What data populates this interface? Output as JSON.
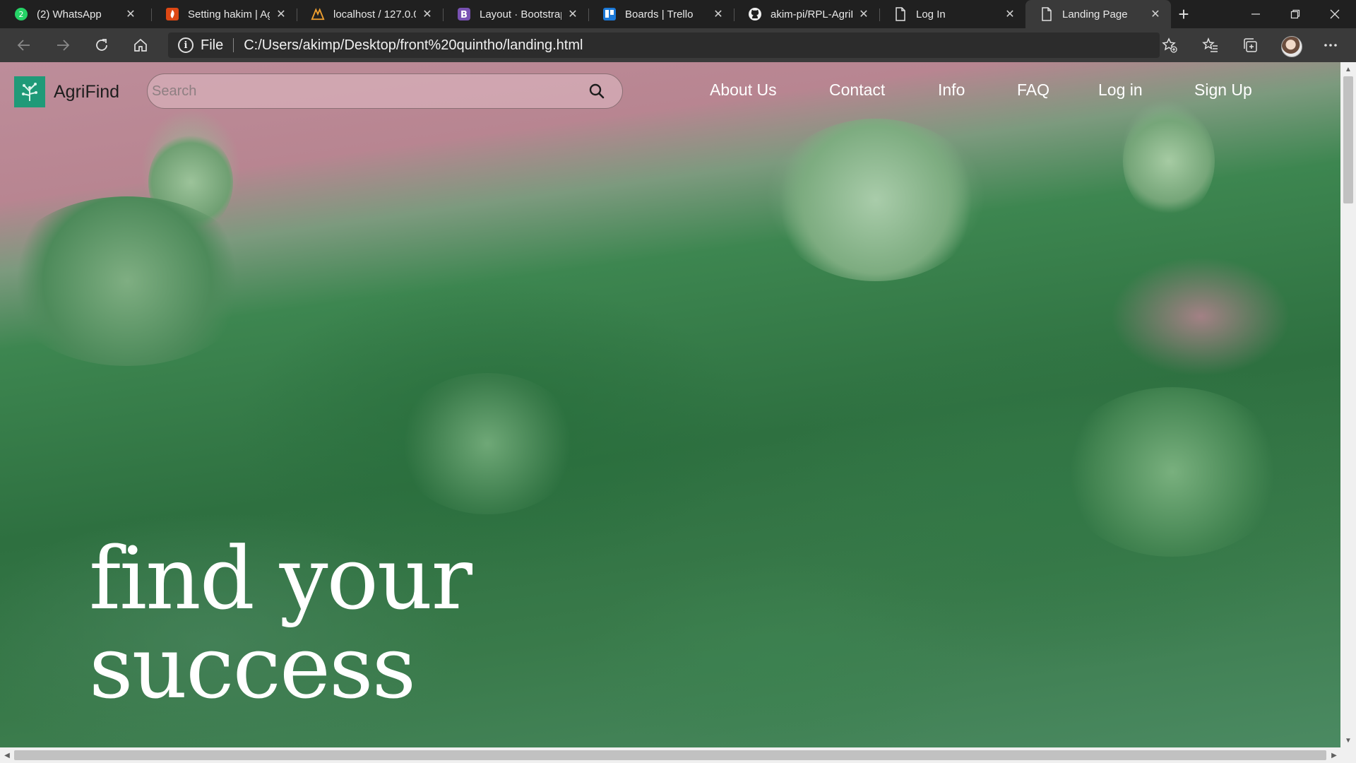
{
  "browser": {
    "tabs": [
      {
        "title": "(2) WhatsApp",
        "icon": "whatsapp-icon",
        "active": false
      },
      {
        "title": "Setting hakim | Ag",
        "icon": "codeigniter-icon",
        "active": false
      },
      {
        "title": "localhost / 127.0.0",
        "icon": "phpmyadmin-icon",
        "active": false
      },
      {
        "title": "Layout · Bootstrap",
        "icon": "bootstrap-icon",
        "active": false
      },
      {
        "title": "Boards | Trello",
        "icon": "trello-icon",
        "active": false
      },
      {
        "title": "akim-pi/RPL-AgriF",
        "icon": "github-icon",
        "active": false
      },
      {
        "title": "Log In",
        "icon": "page-icon",
        "active": false
      },
      {
        "title": "Landing Page",
        "icon": "page-icon",
        "active": true
      }
    ],
    "address": {
      "scheme": "File",
      "url": "C:/Users/akimp/Desktop/front%20quintho/landing.html"
    }
  },
  "page": {
    "brand": {
      "name": "AgriFind",
      "logo_color": "#1f9a78"
    },
    "search": {
      "placeholder": "Search"
    },
    "nav": [
      "About Us",
      "Contact",
      "Info",
      "FAQ",
      "Log in",
      "Sign Up"
    ],
    "headline": {
      "line1": "find your",
      "line2": "success"
    }
  },
  "colors": {
    "tab_bar": "#202020",
    "active_tab": "#3a3a3a",
    "water_pink": "#bd8d9a",
    "forest_green": "#2e7040",
    "text_white": "#ffffff"
  }
}
